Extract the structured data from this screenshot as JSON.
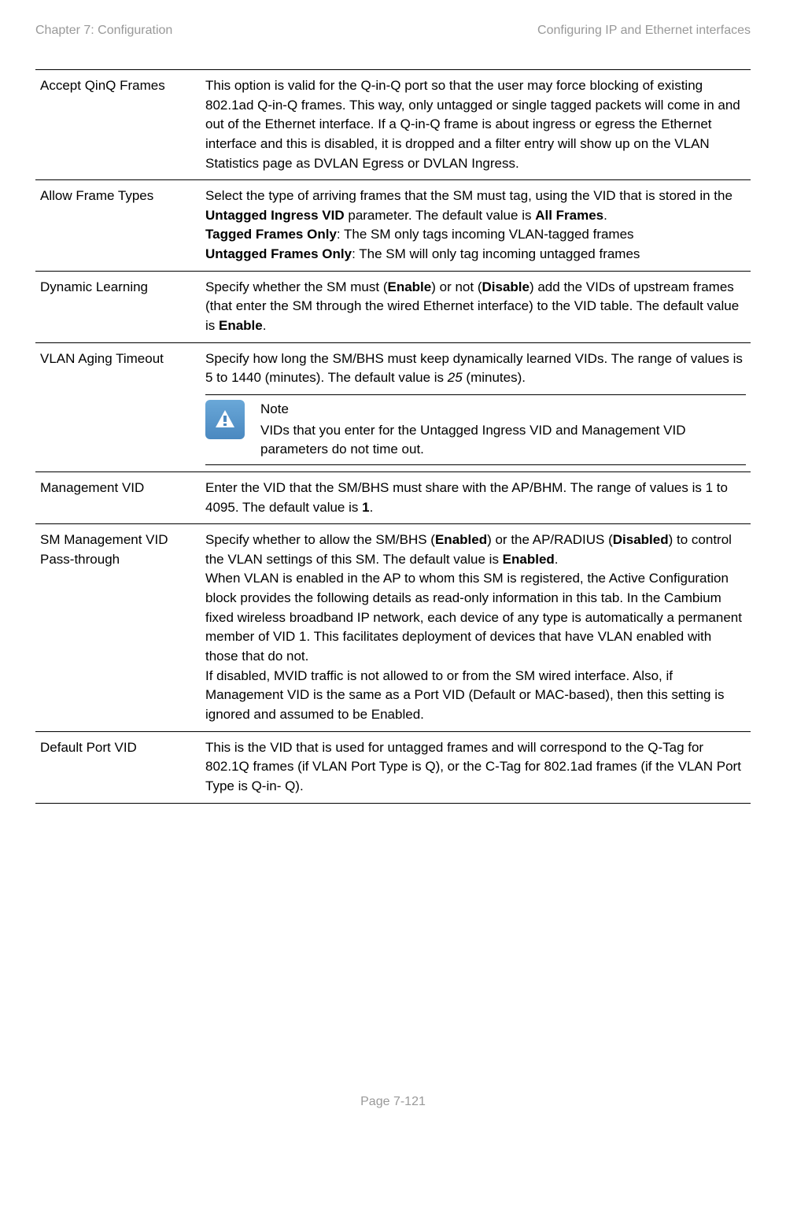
{
  "header": {
    "left": "Chapter 7:  Configuration",
    "right": "Configuring IP and Ethernet interfaces"
  },
  "table": {
    "rows": [
      {
        "attr": "Accept QinQ Frames",
        "desc_html": "This option is valid for the Q-in-Q port so that the user may force blocking of existing 802.1ad Q-in-Q frames. This way, only untagged or single tagged packets will come in and out of the Ethernet interface. If a Q-in-Q frame is about ingress or egress the Ethernet interface and this is disabled, it is dropped and a filter entry will show up on the VLAN Statistics page as DVLAN Egress or DVLAN Ingress."
      },
      {
        "attr": "Allow Frame Types",
        "desc_html": "Select the type of arriving frames that the SM must tag, using the VID that is stored in the <span class=\"bold\">Untagged Ingress VID</span> parameter. The default value is <span class=\"bold\">All Frames</span>.<br><span class=\"bold\">Tagged Frames Only</span>: The SM only tags incoming VLAN-tagged frames<br><span class=\"bold\">Untagged Frames Only</span>: The SM will only tag incoming untagged frames"
      },
      {
        "attr": "Dynamic Learning",
        "desc_html": "Specify whether the SM must (<span class=\"bold\">Enable</span>) or not (<span class=\"bold\">Disable</span>) add the VIDs of upstream frames (that enter the SM through the wired Ethernet interface) to the VID table. The default value is <span class=\"bold\">Enable</span>."
      },
      {
        "attr": "VLAN Aging Timeout",
        "desc_html": "Specify how long the SM/BHS must keep dynamically learned VIDs. The range of values is 5 to 1440 (minutes). The default value is <span class=\"italic\">25</span> (minutes).",
        "has_note": true,
        "note_title": "Note",
        "note_text": "VIDs that you enter for the Untagged Ingress VID and Management VID parameters do not time out."
      },
      {
        "attr": "Management VID",
        "desc_html": "Enter the VID that the SM/BHS must share with the AP/BHM. The range of values is 1 to 4095. The default value is <span class=\"bold\">1</span>."
      },
      {
        "attr": "SM Management VID Pass-through",
        "desc_html": "Specify whether to allow the SM/BHS (<span class=\"bold\">Enabled</span>) or the AP/RADIUS (<span class=\"bold\">Disabled</span>) to control the VLAN settings of this SM. The default value is <span class=\"bold\">Enabled</span>.<br>When VLAN is enabled in the AP to whom this SM is registered, the Active Configuration block provides the following details as read-only information in this tab. In the Cambium fixed wireless broadband IP network, each device of any type is automatically a permanent member of VID 1. This facilitates deployment of devices that have VLAN enabled with those that do not.<br>If disabled, MVID traffic is not allowed to or from the SM wired interface. Also, if Management VID is the same as a Port VID (Default or MAC-based), then this setting is ignored and assumed to be Enabled."
      },
      {
        "attr": "Default Port VID",
        "desc_html": "This is the VID that is used for untagged frames and will correspond to the Q-Tag for 802.1Q frames (if VLAN Port Type is Q), or the C-Tag for 802.1ad frames (if the VLAN Port Type is Q-in- Q)."
      }
    ]
  },
  "footer": {
    "text": "Page 7-121"
  }
}
